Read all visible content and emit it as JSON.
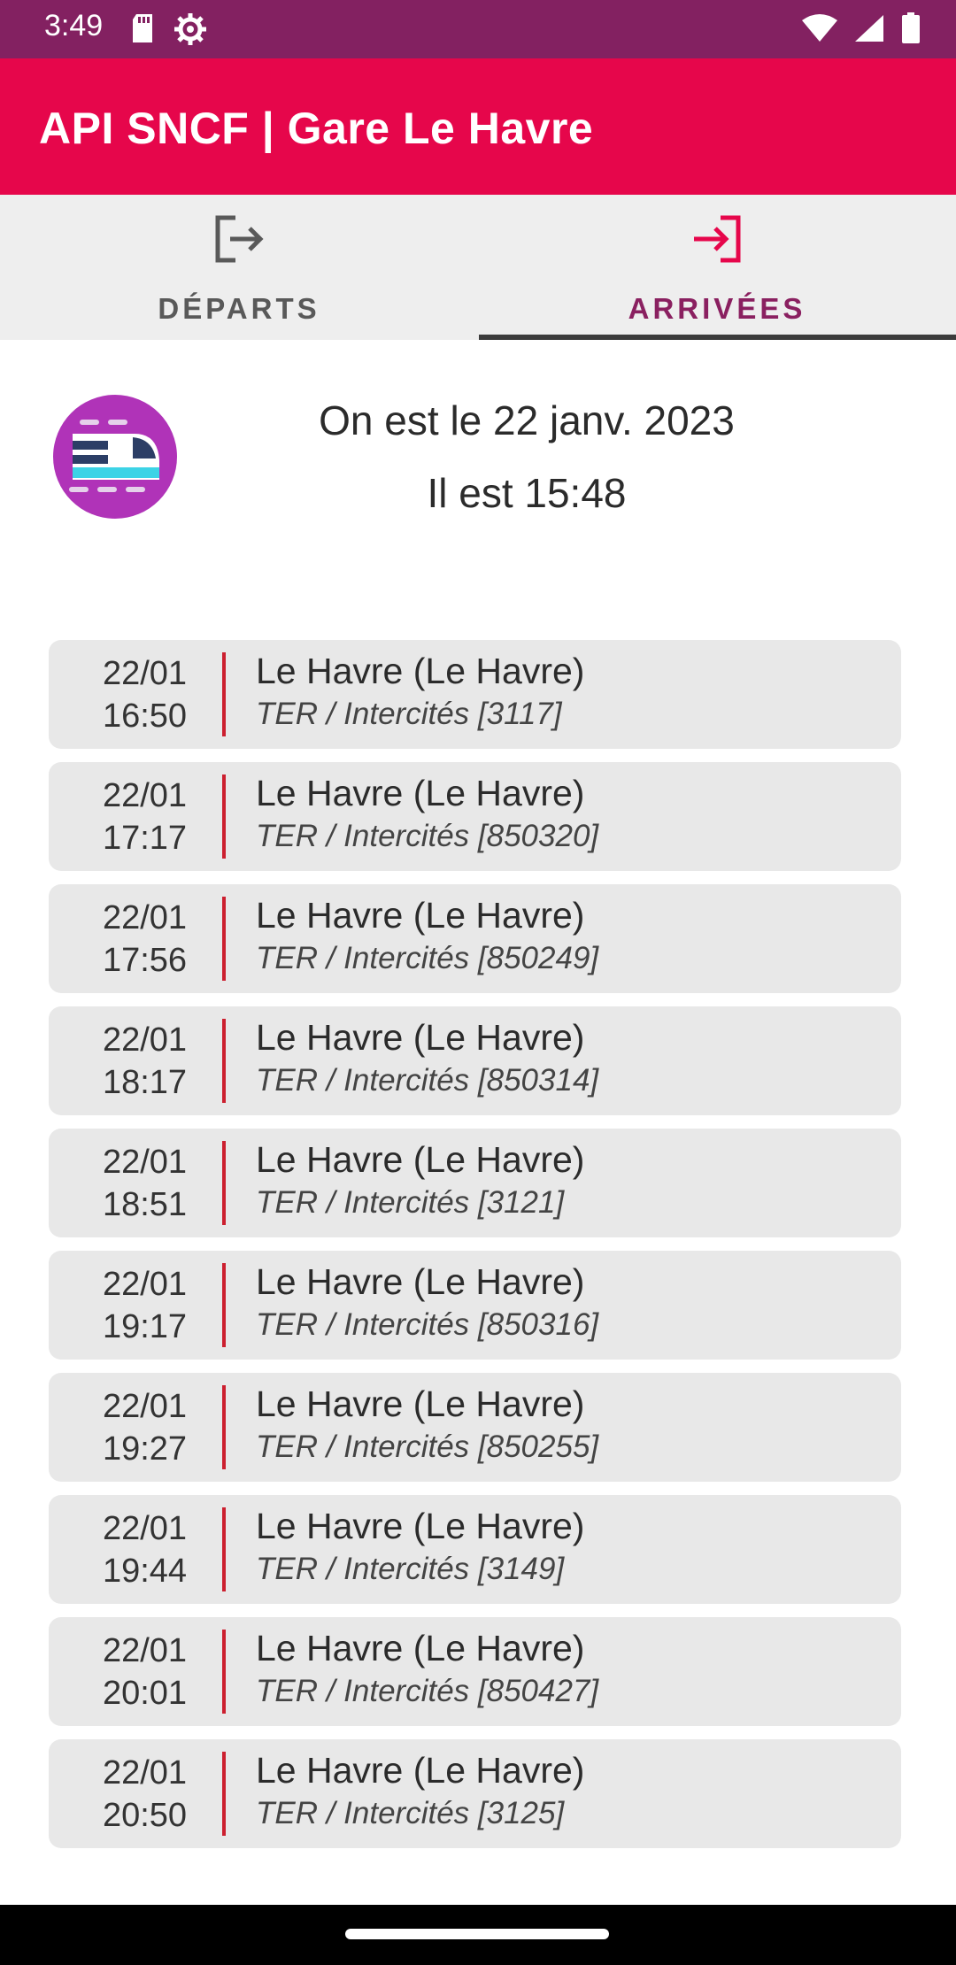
{
  "status_bar": {
    "time": "3:49",
    "left_icons": [
      "sd-card-icon",
      "settings-icon"
    ],
    "right_icons": [
      "wifi-icon",
      "signal-icon",
      "battery-icon"
    ]
  },
  "app_bar": {
    "title": "API SNCF | Gare Le Havre"
  },
  "tabs": [
    {
      "label": "DÉPARTS",
      "icon": "exit-icon",
      "selected": false
    },
    {
      "label": "ARRIVÉES",
      "icon": "enter-icon",
      "selected": true
    }
  ],
  "header": {
    "date_text": "On est le 22 janv. 2023",
    "time_text": "Il est 15:48",
    "logo_icon": "train-logo-icon"
  },
  "arrivals": [
    {
      "date": "22/01",
      "time": "16:50",
      "destination": "Le Havre (Le Havre)",
      "line": "TER / Intercités [3117]"
    },
    {
      "date": "22/01",
      "time": "17:17",
      "destination": "Le Havre (Le Havre)",
      "line": "TER / Intercités [850320]"
    },
    {
      "date": "22/01",
      "time": "17:56",
      "destination": "Le Havre (Le Havre)",
      "line": "TER / Intercités [850249]"
    },
    {
      "date": "22/01",
      "time": "18:17",
      "destination": "Le Havre (Le Havre)",
      "line": "TER / Intercités [850314]"
    },
    {
      "date": "22/01",
      "time": "18:51",
      "destination": "Le Havre (Le Havre)",
      "line": "TER / Intercités [3121]"
    },
    {
      "date": "22/01",
      "time": "19:17",
      "destination": "Le Havre (Le Havre)",
      "line": "TER / Intercités [850316]"
    },
    {
      "date": "22/01",
      "time": "19:27",
      "destination": "Le Havre (Le Havre)",
      "line": "TER / Intercités [850255]"
    },
    {
      "date": "22/01",
      "time": "19:44",
      "destination": "Le Havre (Le Havre)",
      "line": "TER / Intercités [3149]"
    },
    {
      "date": "22/01",
      "time": "20:01",
      "destination": "Le Havre (Le Havre)",
      "line": "TER / Intercités [850427]"
    },
    {
      "date": "22/01",
      "time": "20:50",
      "destination": "Le Havre (Le Havre)",
      "line": "TER / Intercités [3125]"
    }
  ],
  "colors": {
    "status_bar": "#832161",
    "app_bar": "#e6064b",
    "tab_selected": "#8a2060",
    "separator": "#cc1f2f"
  }
}
